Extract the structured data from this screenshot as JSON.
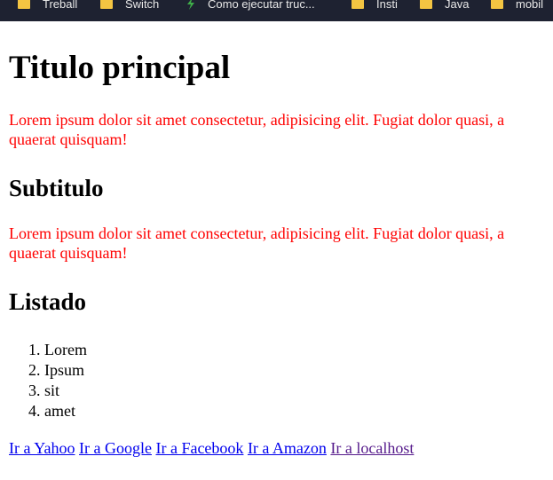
{
  "bookmarks": [
    {
      "label": "Treball",
      "icon": "folder-icon"
    },
    {
      "label": "Switch",
      "icon": "folder-icon"
    },
    {
      "label": "Como ejecutar truc...",
      "icon": "spark-icon"
    },
    {
      "label": "Insti",
      "icon": "folder-icon"
    },
    {
      "label": "Java",
      "icon": "folder-icon"
    },
    {
      "label": "mobil",
      "icon": "folder-icon"
    }
  ],
  "colors": {
    "bookmarks_bar": "#1e2231",
    "folder": "#f4c542",
    "paragraph": "#ff0000",
    "link": "#0000ee",
    "visited_link": "#551a8b"
  },
  "page": {
    "title": "Titulo principal",
    "paragraph1": {
      "line1": "Lorem ipsum dolor sit amet consectetur, adipisicing elit. Fugiat dolor quasi, a",
      "line2": "quaerat quisquam!"
    },
    "subtitle": "Subtitulo",
    "paragraph2": {
      "line1": "Lorem ipsum dolor sit amet consectetur, adipisicing elit. Fugiat dolor quasi, a",
      "line2": "quaerat quisquam!"
    },
    "list_heading": "Listado",
    "list_items": [
      "Lorem",
      "Ipsum",
      "sit",
      "amet"
    ],
    "links": [
      {
        "label": "Ir a Yahoo"
      },
      {
        "label": "Ir a Google"
      },
      {
        "label": "Ir a Facebook"
      },
      {
        "label": "Ir a Amazon"
      },
      {
        "label": "Ir a localhost",
        "visited": true
      }
    ]
  }
}
